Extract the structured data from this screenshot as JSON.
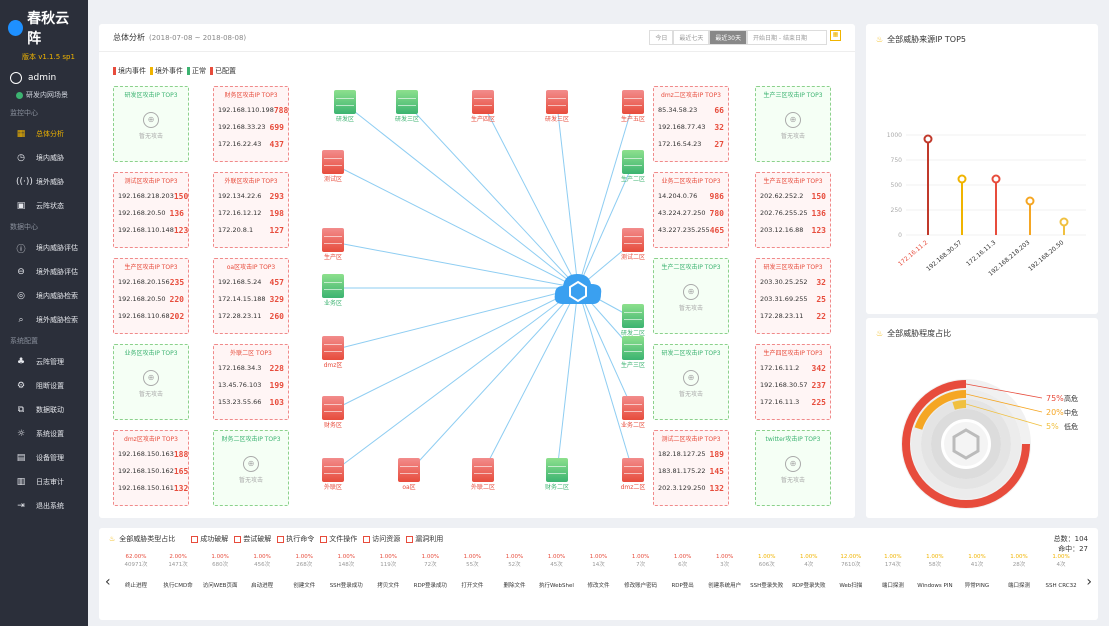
{
  "app": {
    "name": "春秋云阵",
    "version": "版本 v1.1.5 sp1",
    "user": "admin",
    "env": "研发内网场景"
  },
  "sidebar": [
    {
      "type": "sec",
      "label": "监控中心"
    },
    {
      "type": "nav",
      "label": "总体分析",
      "icon": "grid-icon",
      "active": true
    },
    {
      "type": "nav",
      "label": "境内威胁",
      "icon": "clock-icon"
    },
    {
      "type": "nav",
      "label": "境外威胁",
      "icon": "signal-icon"
    },
    {
      "type": "nav",
      "label": "云阵状态",
      "icon": "calendar-icon"
    },
    {
      "type": "sec",
      "label": "数据中心"
    },
    {
      "type": "nav",
      "label": "境内威胁评估",
      "icon": "info-icon"
    },
    {
      "type": "nav",
      "label": "境外威胁评估",
      "icon": "dots-icon"
    },
    {
      "type": "nav",
      "label": "境内威胁检索",
      "icon": "target-icon"
    },
    {
      "type": "nav",
      "label": "境外威胁检索",
      "icon": "search-icon"
    },
    {
      "type": "sec",
      "label": "系统配置"
    },
    {
      "type": "nav",
      "label": "云阵管理",
      "icon": "network-icon"
    },
    {
      "type": "nav",
      "label": "阻断设置",
      "icon": "gear-icon"
    },
    {
      "type": "nav",
      "label": "数据联动",
      "icon": "link-icon"
    },
    {
      "type": "nav",
      "label": "系统设置",
      "icon": "settings-icon"
    },
    {
      "type": "nav",
      "label": "设备管理",
      "icon": "device-icon"
    },
    {
      "type": "nav",
      "label": "日志审计",
      "icon": "log-icon"
    },
    {
      "type": "nav",
      "label": "退出系统",
      "icon": "exit-icon"
    }
  ],
  "header": {
    "title": "总体分析",
    "date": "(2018-07-08 ~ 2018-08-08)",
    "tabs": [
      "今日",
      "最近七天",
      "最近30天"
    ],
    "active_tab": "最近30天",
    "range": "开始日期 - 结束日期"
  },
  "legend": [
    {
      "label": "境内事件",
      "color": "#e74c3c"
    },
    {
      "label": "境外事件",
      "color": "#f0b400"
    },
    {
      "label": "正常",
      "color": "#3cb371"
    },
    {
      "label": "已配置",
      "color": "#e74c3c"
    }
  ],
  "cards_left": [
    {
      "title": "研发区攻击IP TOP3",
      "type": "green",
      "empty": "暂无攻击"
    },
    {
      "title": "财务区攻击IP TOP3",
      "type": "red",
      "rows": [
        [
          "192.168.110.198",
          "788"
        ],
        [
          "192.168.33.23",
          "699"
        ],
        [
          "172.16.22.43",
          "437"
        ]
      ]
    },
    {
      "title": "测试区攻击IP TOP3",
      "type": "red",
      "rows": [
        [
          "192.168.218.203",
          "150"
        ],
        [
          "192.168.20.50",
          "136"
        ],
        [
          "192.168.110.148",
          "123"
        ]
      ]
    },
    {
      "title": "外联区攻击IP TOP3",
      "type": "red",
      "rows": [
        [
          "192.134.22.6",
          "293"
        ],
        [
          "172.16.12.12",
          "198"
        ],
        [
          "172.20.8.1",
          "127"
        ]
      ]
    },
    {
      "title": "生产区攻击IP TOP3",
      "type": "red",
      "rows": [
        [
          "192.168.20.156",
          "235"
        ],
        [
          "192.168.20.50",
          "220"
        ],
        [
          "192.168.110.68",
          "202"
        ]
      ]
    },
    {
      "title": "oa区攻击IP TOP3",
      "type": "red",
      "rows": [
        [
          "192.168.5.24",
          "457"
        ],
        [
          "172.14.15.188",
          "329"
        ],
        [
          "172.28.23.11",
          "260"
        ]
      ]
    },
    {
      "title": "业务区攻击IP TOP3",
      "type": "green",
      "empty": "暂无攻击"
    },
    {
      "title": "外联二区 TOP3",
      "type": "red",
      "rows": [
        [
          "172.168.34.3",
          "228"
        ],
        [
          "13.45.76.103",
          "199"
        ],
        [
          "153.23.55.66",
          "103"
        ]
      ]
    },
    {
      "title": "dmz区攻击IP TOP3",
      "type": "red",
      "rows": [
        [
          "192.168.150.163",
          "188"
        ],
        [
          "192.168.150.162",
          "165"
        ],
        [
          "192.168.150.161",
          "132"
        ]
      ]
    },
    {
      "title": "财务二区攻击IP TOP3",
      "type": "green",
      "empty": "暂无攻击"
    }
  ],
  "cards_right": [
    {
      "title": "dmz二区攻击IP TOP3",
      "type": "red",
      "rows": [
        [
          "85.34.58.23",
          "66"
        ],
        [
          "192.168.77.43",
          "32"
        ],
        [
          "172.16.54.23",
          "27"
        ]
      ]
    },
    {
      "title": "生产三区攻击IP TOP3",
      "type": "green",
      "empty": "暂无攻击"
    },
    {
      "title": "业务二区攻击IP TOP3",
      "type": "red",
      "rows": [
        [
          "14.204.0.76",
          "986"
        ],
        [
          "43.224.27.250",
          "780"
        ],
        [
          "43.227.235.255",
          "465"
        ]
      ]
    },
    {
      "title": "生产五区攻击IP TOP3",
      "type": "red",
      "rows": [
        [
          "202.62.252.2",
          "150"
        ],
        [
          "202.76.255.25",
          "136"
        ],
        [
          "203.12.16.88",
          "123"
        ]
      ]
    },
    {
      "title": "生产二区攻击IP TOP3",
      "type": "green",
      "empty": "暂无攻击"
    },
    {
      "title": "研发三区攻击IP TOP3",
      "type": "red",
      "rows": [
        [
          "203.30.25.252",
          "32"
        ],
        [
          "203.31.69.255",
          "25"
        ],
        [
          "172.28.23.11",
          "22"
        ]
      ]
    },
    {
      "title": "研发二区攻击IP TOP3",
      "type": "green",
      "empty": "暂无攻击"
    },
    {
      "title": "生产四区攻击IP TOP3",
      "type": "red",
      "rows": [
        [
          "172.16.11.2",
          "342"
        ],
        [
          "192.168.30.57",
          "237"
        ],
        [
          "172.16.11.3",
          "225"
        ]
      ]
    },
    {
      "title": "测试二区攻击IP TOP3",
      "type": "red",
      "rows": [
        [
          "182.18.127.25",
          "189"
        ],
        [
          "183.81.175.22",
          "145"
        ],
        [
          "202.3.129.250",
          "132"
        ]
      ]
    },
    {
      "title": "twitter攻击IP TOP3",
      "type": "green",
      "empty": "暂无攻击"
    }
  ],
  "nodes": [
    {
      "label": "研发区",
      "c": "g"
    },
    {
      "label": "研发三区",
      "c": "g"
    },
    {
      "label": "生产四区",
      "c": "r"
    },
    {
      "label": "研发三区",
      "c": "r"
    },
    {
      "label": "生产五区",
      "c": "r"
    },
    {
      "label": "测试区",
      "c": "r"
    },
    {
      "label": "生产二区",
      "c": "g"
    },
    {
      "label": "生产区",
      "c": "r"
    },
    {
      "label": "测试二区",
      "c": "r"
    },
    {
      "label": "业务区",
      "c": "g"
    },
    {
      "label": "研发二区",
      "c": "g"
    },
    {
      "label": "dmz区",
      "c": "r"
    },
    {
      "label": "生产三区",
      "c": "g"
    },
    {
      "label": "财务区",
      "c": "r"
    },
    {
      "label": "业务二区",
      "c": "r"
    },
    {
      "label": "外联区",
      "c": "r"
    },
    {
      "label": "oa区",
      "c": "r"
    },
    {
      "label": "外联二区",
      "c": "r"
    },
    {
      "label": "财务二区",
      "c": "g"
    },
    {
      "label": "dmz二区",
      "c": "r"
    }
  ],
  "top5": {
    "title": "全部威胁来源IP TOP5"
  },
  "severity": {
    "title": "全部威胁程度占比"
  },
  "chart_data": [
    {
      "type": "lollipop",
      "title": "全部威胁来源IP TOP5",
      "categories": [
        "172.16.11.2",
        "192.168.30.57",
        "172.16.11.3",
        "192.168.218.203",
        "192.168.20.50"
      ],
      "values": [
        960,
        560,
        560,
        340,
        130
      ],
      "yticks": [
        "1000",
        "750",
        "500",
        "250",
        "0"
      ],
      "ylim": [
        0,
        1000
      ]
    },
    {
      "type": "pie",
      "title": "全部威胁程度占比",
      "labels": [
        {
          "pct": "75%",
          "name": "高危",
          "value": 75,
          "color": "#e74c3c"
        },
        {
          "pct": "20%",
          "name": "中危",
          "value": 20,
          "color": "#f5a623"
        },
        {
          "pct": "5%",
          "name": "低危",
          "value": 5,
          "color": "#f0c040"
        }
      ]
    }
  ],
  "bottom": {
    "title": "全部威胁类型占比",
    "total": "总数：104",
    "hit": "命中：27",
    "legend": [
      "成功破解",
      "尝试破解",
      "执行命令",
      "文件操作",
      "访问资源",
      "漏洞利用"
    ],
    "cols": [
      {
        "p": "62.00%",
        "n": "40971次",
        "l": "终止进程"
      },
      {
        "p": "2.00%",
        "n": "1471次",
        "l": "执行CMD命"
      },
      {
        "p": "1.00%",
        "n": "680次",
        "l": "访问WEB页面"
      },
      {
        "p": "1.00%",
        "n": "456次",
        "l": "启动进程"
      },
      {
        "p": "1.00%",
        "n": "268次",
        "l": "创建文件"
      },
      {
        "p": "1.00%",
        "n": "148次",
        "l": "SSH登录成功"
      },
      {
        "p": "1.00%",
        "n": "119次",
        "l": "拷贝文件"
      },
      {
        "p": "1.00%",
        "n": "72次",
        "l": "RDP登录成功"
      },
      {
        "p": "1.00%",
        "n": "55次",
        "l": "打开文件"
      },
      {
        "p": "1.00%",
        "n": "52次",
        "l": "删除文件"
      },
      {
        "p": "1.00%",
        "n": "45次",
        "l": "执行WebShel"
      },
      {
        "p": "1.00%",
        "n": "14次",
        "l": "修改文件"
      },
      {
        "p": "1.00%",
        "n": "7次",
        "l": "修改账户密码"
      },
      {
        "p": "1.00%",
        "n": "6次",
        "l": "RDP登出"
      },
      {
        "p": "1.00%",
        "n": "3次",
        "l": "创建系统用户"
      },
      {
        "p": "1.00%",
        "n": "606次",
        "l": "SSH登录失败"
      },
      {
        "p": "1.00%",
        "n": "4次",
        "l": "RDP登录失败"
      },
      {
        "p": "12.00%",
        "n": "7610次",
        "l": "Web扫描"
      },
      {
        "p": "1.00%",
        "n": "174次",
        "l": "端口探测"
      },
      {
        "p": "1.00%",
        "n": "58次",
        "l": "Windows PIN"
      },
      {
        "p": "1.00%",
        "n": "41次",
        "l": "异常PING"
      },
      {
        "p": "1.00%",
        "n": "28次",
        "l": "端口探测"
      },
      {
        "p": "1.00%",
        "n": "4次",
        "l": "SSH CRC32"
      }
    ]
  }
}
